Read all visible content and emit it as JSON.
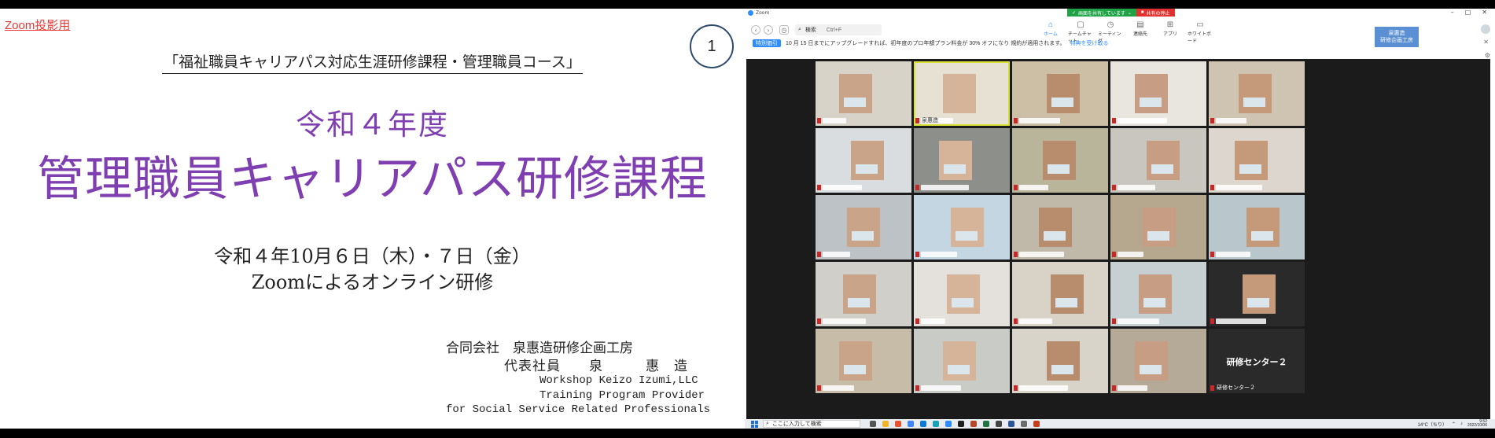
{
  "slide": {
    "zoom_tag": "Zoom投影用",
    "page_number": "1",
    "course_subtitle": "「福祉職員キャリアパス対応生涯研修課程・管理職員コース」",
    "year": "令和４年度",
    "main_title": "管理職員キャリアパス研修課程",
    "dates": "令和４年10月６日（木）・７日（金）",
    "online": "Zoomによるオンライン研修",
    "org": "合同会社　泉惠造研修企画工房",
    "representative": "代表社員　　泉　　　惠　造",
    "english_lines": [
      "Workshop Keizo Izumi,LLC",
      "Training Program Provider",
      "for Social Service Related Professionals"
    ]
  },
  "zoom": {
    "app_name": "Zoom",
    "share_status": "画面を共有しています",
    "stop_share": "共有の停止",
    "search_label": "検索",
    "search_shortcut": "Ctrl+F",
    "tabs": [
      {
        "label": "ホーム",
        "icon": "home-icon",
        "glyph": "⌂"
      },
      {
        "label": "チームチャット",
        "icon": "chat-icon",
        "glyph": "▢"
      },
      {
        "label": "ミーティング",
        "icon": "clock-icon",
        "glyph": "◷"
      },
      {
        "label": "連絡先",
        "icon": "contacts-icon",
        "glyph": "▤"
      },
      {
        "label": "アプリ",
        "icon": "apps-icon",
        "glyph": "⊞"
      },
      {
        "label": "ホワイトボード",
        "icon": "whiteboard-icon",
        "glyph": "▭"
      }
    ],
    "brand_badge": [
      "泉惠造",
      "研修企画工房"
    ],
    "promo": {
      "label": "特別価引",
      "text": "10 月 15 日までにアップグレードすれば、初年度のプロ年額プラン料金が 30% オフになり 規約が適用されます。",
      "link": "特典を受け取る"
    },
    "named_tile": {
      "center_name": "研修センター２",
      "label": "研修センター２"
    },
    "host_label": "泉惠造",
    "taskbar": {
      "search_placeholder": "ここに入力して検索",
      "weather": "14°C（ちり）",
      "time": "9:52",
      "date": "2022/10/06"
    }
  },
  "colors": {
    "title_purple": "#7f3fb1",
    "zoom_blue": "#2d8cff",
    "share_green": "#1fa346",
    "share_red": "#e0312e"
  }
}
